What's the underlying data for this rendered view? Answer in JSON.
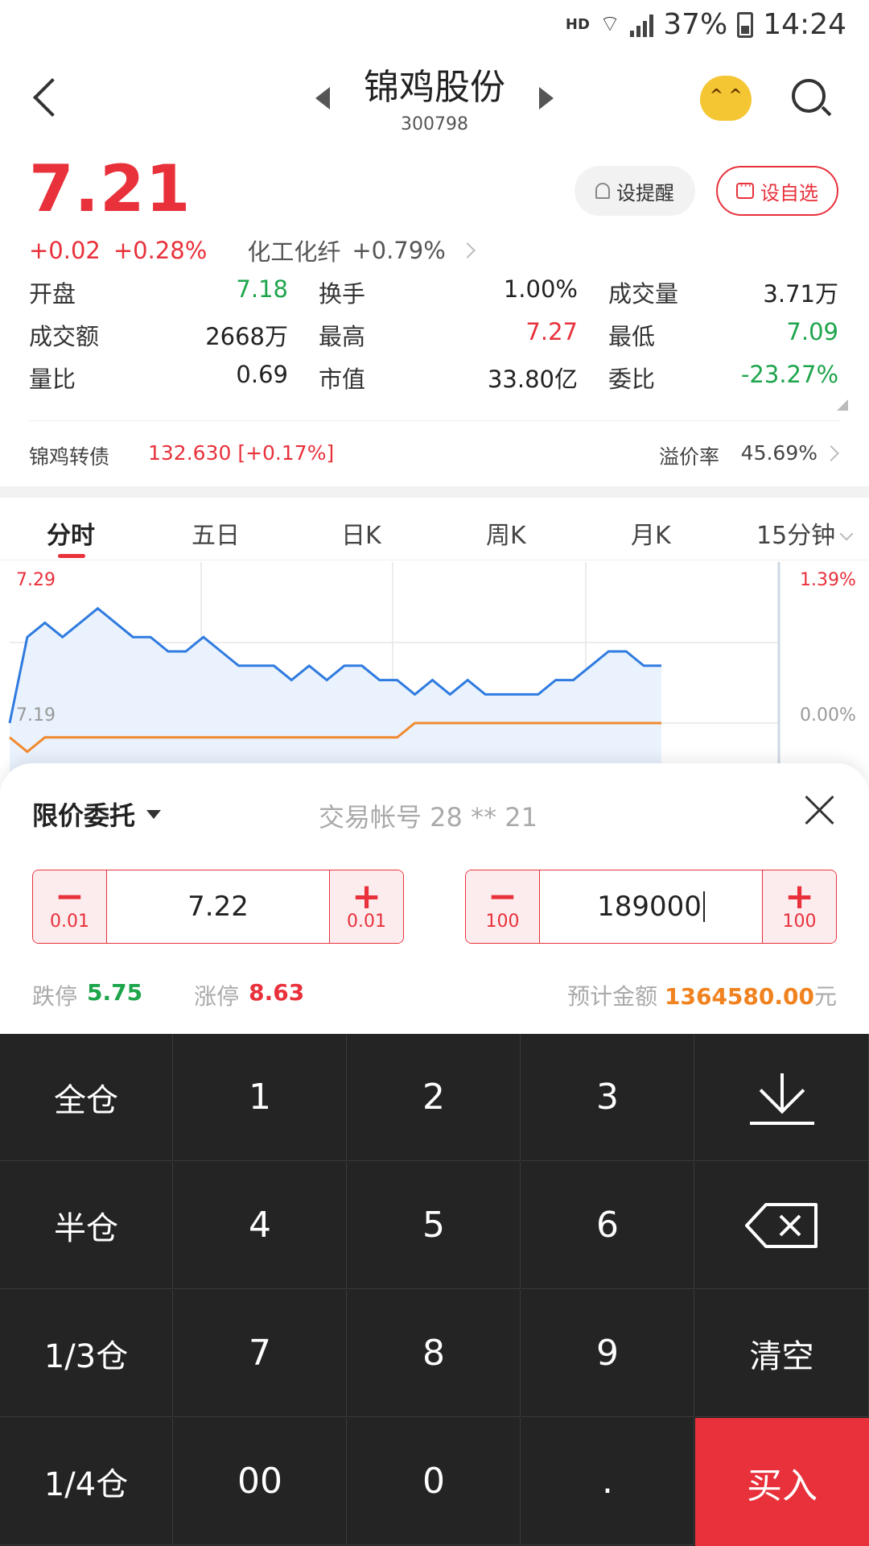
{
  "status_bar": {
    "network": "HD",
    "signal": "4G",
    "battery": "37%",
    "time": "14:24"
  },
  "header": {
    "title": "锦鸡股份",
    "code": "300798"
  },
  "quote": {
    "price": "7.21",
    "change": "+0.02",
    "change_pct": "+0.28%",
    "sector": "化工化纤",
    "sector_pct": "+0.79%",
    "alert_label": "设提醒",
    "fav_label": "设自选"
  },
  "stats": [
    [
      {
        "label": "开盘",
        "value": "7.18",
        "color": "green"
      },
      {
        "label": "换手",
        "value": "1.00%",
        "color": "black"
      },
      {
        "label": "成交量",
        "value": "3.71万",
        "color": "black"
      }
    ],
    [
      {
        "label": "成交额",
        "value": "2668万",
        "color": "black"
      },
      {
        "label": "最高",
        "value": "7.27",
        "color": "red"
      },
      {
        "label": "最低",
        "value": "7.09",
        "color": "green"
      }
    ],
    [
      {
        "label": "量比",
        "value": "0.69",
        "color": "black"
      },
      {
        "label": "市值",
        "value": "33.80亿",
        "color": "black"
      },
      {
        "label": "委比",
        "value": "-23.27%",
        "color": "green"
      }
    ]
  ],
  "bond": {
    "label": "锦鸡转债",
    "value": "132.630 [+0.17%]",
    "premium_label": "溢价率",
    "premium_value": "45.69%"
  },
  "tabs": [
    "分时",
    "五日",
    "日K",
    "周K",
    "月K",
    "15分钟"
  ],
  "chart_data": {
    "type": "line",
    "y_left_ticks": [
      "7.29",
      "7.19"
    ],
    "y_right_ticks": [
      "1.39%",
      "0.00%"
    ],
    "series": [
      {
        "color": "#2f7be0",
        "values": [
          7.19,
          7.25,
          7.26,
          7.25,
          7.26,
          7.27,
          7.26,
          7.25,
          7.25,
          7.24,
          7.24,
          7.25,
          7.24,
          7.23,
          7.23,
          7.23,
          7.22,
          7.23,
          7.22,
          7.23,
          7.23,
          7.22,
          7.22,
          7.21,
          7.22,
          7.21,
          7.22,
          7.21,
          7.21,
          7.21,
          7.21,
          7.22,
          7.22,
          7.23,
          7.24,
          7.24,
          7.23,
          7.23
        ]
      },
      {
        "color": "#f08a30",
        "values": [
          7.18,
          7.17,
          7.18,
          7.18,
          7.18,
          7.18,
          7.18,
          7.18,
          7.18,
          7.18,
          7.18,
          7.18,
          7.18,
          7.18,
          7.18,
          7.18,
          7.18,
          7.18,
          7.18,
          7.18,
          7.18,
          7.18,
          7.18,
          7.19,
          7.19,
          7.19,
          7.19,
          7.19,
          7.19,
          7.19,
          7.19,
          7.19,
          7.19,
          7.19,
          7.19,
          7.19,
          7.19,
          7.19
        ]
      }
    ],
    "colors": {
      "price": "#2f7be0",
      "avg": "#f08a30",
      "up": "#e8313b"
    }
  },
  "order": {
    "type_label": "限价委托",
    "account": "交易帐号  28 ** 21",
    "price_value": "7.22",
    "price_step": "0.01",
    "qty_value": "189000",
    "qty_step": "100",
    "limit_down_label": "跌停",
    "limit_down_value": "5.75",
    "limit_up_label": "涨停",
    "limit_up_value": "8.63",
    "estimate_label": "预计金额",
    "estimate_value": "1364580.00",
    "estimate_unit": "元"
  },
  "keypad": [
    [
      "全仓",
      "1",
      "2",
      "3",
      "download-icon"
    ],
    [
      "半仓",
      "4",
      "5",
      "6",
      "backspace-icon"
    ],
    [
      "1/3仓",
      "7",
      "8",
      "9",
      "清空"
    ],
    [
      "1/4仓",
      "00",
      "0",
      ".",
      "买入"
    ]
  ]
}
